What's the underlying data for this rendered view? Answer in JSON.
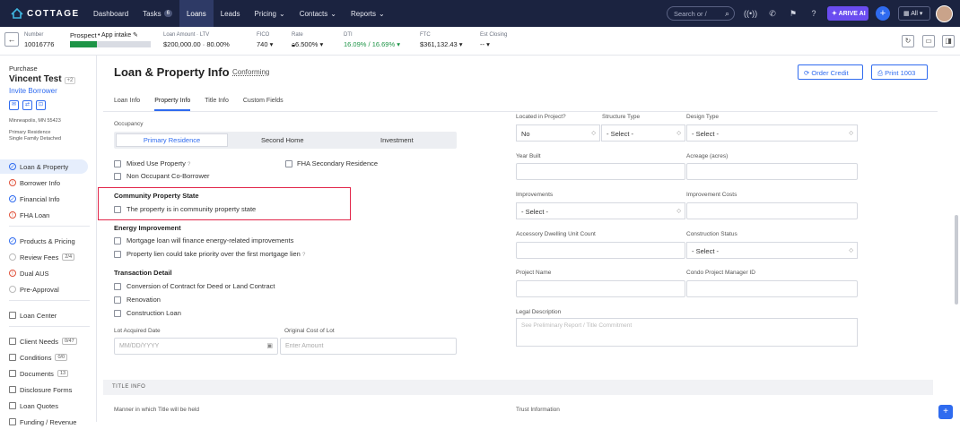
{
  "brand": {
    "name": "COTTAGE"
  },
  "nav": {
    "items": [
      "Dashboard",
      "Tasks",
      "Loans",
      "Leads",
      "Pricing",
      "Contacts",
      "Reports"
    ],
    "tasks_badge": "6",
    "search_placeholder": "Search or /",
    "arive_label": "ARIVE AI",
    "all_label": "All"
  },
  "loanbar": {
    "number_label": "Number",
    "number": "10016776",
    "stage": "Prospect",
    "stage_next": "App intake",
    "amount_label": "Loan Amount · LTV",
    "amount": "$200,000.00 · 80.00%",
    "fico_label": "FICO",
    "fico": "740",
    "rate_label": "Rate",
    "rate": "6.500%",
    "dti_label": "DTI",
    "dti": "16.09% / 16.69%",
    "ftc_label": "FTC",
    "ftc": "$361,132.43",
    "close_label": "Est Closing",
    "close": "-- ",
    "progress": 0.33
  },
  "sidebar": {
    "purchase": "Purchase",
    "name": "Vincent Test",
    "plus": "+2",
    "invite": "Invite Borrower",
    "location": "Minneapolis, MN 55423",
    "residence": "Primary Residence",
    "home_type": "Single Family Detached",
    "menu": [
      {
        "label": "Loan & Property",
        "icon": "check"
      },
      {
        "label": "Borrower Info",
        "icon": "warn"
      },
      {
        "label": "Financial Info",
        "icon": "check"
      },
      {
        "label": "FHA Loan",
        "icon": "warn"
      },
      {
        "label": "Products & Pricing",
        "icon": "check"
      },
      {
        "label": "Review Fees",
        "icon": "none",
        "badge": "2/4"
      },
      {
        "label": "Dual AUS",
        "icon": "warn"
      },
      {
        "label": "Pre-Approval",
        "icon": "none"
      },
      {
        "label": "Loan Center",
        "icon": "sq"
      },
      {
        "label": "Client Needs",
        "icon": "sq",
        "badge": "0/47"
      },
      {
        "label": "Conditions",
        "icon": "sq",
        "badge": "0/0"
      },
      {
        "label": "Documents",
        "icon": "sq",
        "badge": "13"
      },
      {
        "label": "Disclosure Forms",
        "icon": "sq"
      },
      {
        "label": "Loan Quotes",
        "icon": "sq"
      },
      {
        "label": "Funding / Revenue",
        "icon": "sq"
      }
    ]
  },
  "main": {
    "title": "Loan & Property Info",
    "subtitle": "Conforming",
    "order_credit": "Order Credit",
    "print": "Print 1003",
    "tabs": [
      "Loan Info",
      "Property Info",
      "Title Info",
      "Custom Fields"
    ],
    "occupancy_label": "Occupancy",
    "occupancy": [
      "Primary Residence",
      "Second Home",
      "Investment"
    ],
    "mixed_use": "Mixed Use Property",
    "fha_secondary": "FHA Secondary Residence",
    "non_occupant": "Non Occupant Co-Borrower",
    "community_title": "Community Property State",
    "community_cb": "The property is in community property state",
    "energy_title": "Energy Improvement",
    "energy1": "Mortgage loan will finance energy-related improvements",
    "energy2": "Property lien could take priority over the first mortgage lien",
    "transaction_title": "Transaction Detail",
    "t1": "Conversion of Contract for Deed or Land Contract",
    "t2": "Renovation",
    "t3": "Construction Loan",
    "lot_date_label": "Lot Acquired Date",
    "lot_date_ph": "MM/DD/YYYY",
    "lot_cost_label": "Original Cost of Lot",
    "lot_cost_ph": "Enter Amount",
    "located_label": "Located in Project?",
    "located_val": "No",
    "structure_label": "Structure Type",
    "structure_val": "- Select -",
    "design_label": "Design Type",
    "design_val": "- Select -",
    "year_label": "Year Built",
    "acreage_label": "Acreage (acres)",
    "improvements_label": "Improvements",
    "improvements_val": "- Select -",
    "improvement_costs_label": "Improvement Costs",
    "adu_label": "Accessory Dwelling Unit Count",
    "construction_label": "Construction Status",
    "construction_val": "- Select -",
    "project_name_label": "Project Name",
    "condo_label": "Condo Project Manager ID",
    "legal_label": "Legal Description",
    "legal_ph": "See Preliminary Report / Title Commitment",
    "title_info": "TITLE INFO",
    "manner_label": "Manner in which Title will be held",
    "trust_label": "Trust Information"
  }
}
